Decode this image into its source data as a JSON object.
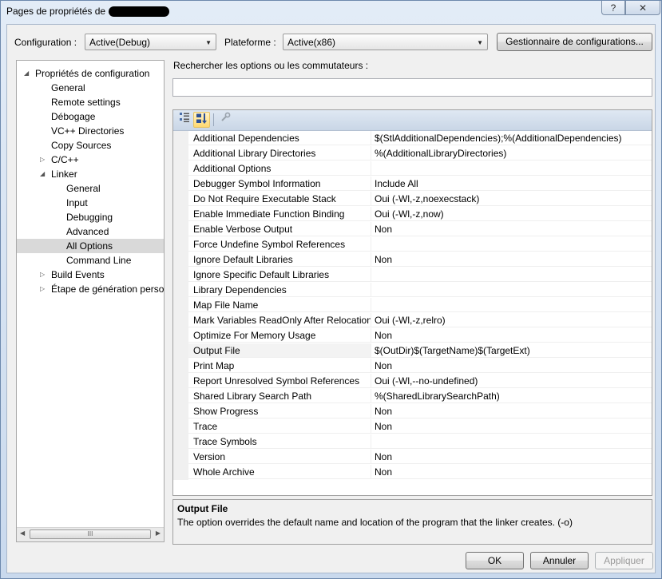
{
  "window": {
    "title": "Pages de propriétés de",
    "help_label": "?",
    "close_label": "✕"
  },
  "config_bar": {
    "configuration_label": "Configuration :",
    "configuration_value": "Active(Debug)",
    "platform_label": "Plateforme :",
    "platform_value": "Active(x86)",
    "manager_button": "Gestionnaire de configurations..."
  },
  "tree": {
    "items": [
      {
        "label": "Propriétés de configuration",
        "level": 0,
        "toggle": "expanded"
      },
      {
        "label": "General",
        "level": 1,
        "toggle": "none"
      },
      {
        "label": "Remote settings",
        "level": 1,
        "toggle": "none"
      },
      {
        "label": "Débogage",
        "level": 1,
        "toggle": "none"
      },
      {
        "label": "VC++ Directories",
        "level": 1,
        "toggle": "none"
      },
      {
        "label": "Copy Sources",
        "level": 1,
        "toggle": "none"
      },
      {
        "label": "C/C++",
        "level": 1,
        "toggle": "collapsed"
      },
      {
        "label": "Linker",
        "level": 1,
        "toggle": "expanded"
      },
      {
        "label": "General",
        "level": 2,
        "toggle": "none"
      },
      {
        "label": "Input",
        "level": 2,
        "toggle": "none"
      },
      {
        "label": "Debugging",
        "level": 2,
        "toggle": "none"
      },
      {
        "label": "Advanced",
        "level": 2,
        "toggle": "none"
      },
      {
        "label": "All Options",
        "level": 2,
        "toggle": "none",
        "selected": true
      },
      {
        "label": "Command Line",
        "level": 2,
        "toggle": "none"
      },
      {
        "label": "Build Events",
        "level": 1,
        "toggle": "collapsed"
      },
      {
        "label": "Étape de génération person",
        "level": 1,
        "toggle": "collapsed"
      }
    ],
    "scroll_left": "◀",
    "scroll_right": "▶",
    "scroll_thumb_grip": "III"
  },
  "search": {
    "label": "Rechercher les options ou les commutateurs :",
    "value": ""
  },
  "grid": {
    "rows": [
      {
        "name": "Additional Dependencies",
        "value": "$(StlAdditionalDependencies);%(AdditionalDependencies)"
      },
      {
        "name": "Additional Library Directories",
        "value": "%(AdditionalLibraryDirectories)"
      },
      {
        "name": "Additional Options",
        "value": ""
      },
      {
        "name": "Debugger Symbol Information",
        "value": "Include All"
      },
      {
        "name": "Do Not Require Executable Stack",
        "value": "Oui (-Wl,-z,noexecstack)"
      },
      {
        "name": "Enable Immediate Function Binding",
        "value": "Oui (-Wl,-z,now)"
      },
      {
        "name": "Enable Verbose Output",
        "value": "Non"
      },
      {
        "name": "Force Undefine Symbol References",
        "value": ""
      },
      {
        "name": "Ignore Default Libraries",
        "value": "Non"
      },
      {
        "name": "Ignore Specific Default Libraries",
        "value": ""
      },
      {
        "name": "Library Dependencies",
        "value": ""
      },
      {
        "name": "Map File Name",
        "value": ""
      },
      {
        "name": "Mark Variables ReadOnly After Relocation",
        "value": "Oui (-Wl,-z,relro)"
      },
      {
        "name": "Optimize For Memory Usage",
        "value": "Non"
      },
      {
        "name": "Output File",
        "value": "$(OutDir)$(TargetName)$(TargetExt)",
        "selected": true
      },
      {
        "name": "Print Map",
        "value": "Non"
      },
      {
        "name": "Report Unresolved Symbol References",
        "value": "Oui (-Wl,--no-undefined)"
      },
      {
        "name": "Shared Library Search Path",
        "value": "%(SharedLibrarySearchPath)"
      },
      {
        "name": "Show Progress",
        "value": "Non"
      },
      {
        "name": "Trace",
        "value": "Non"
      },
      {
        "name": "Trace Symbols",
        "value": ""
      },
      {
        "name": "Version",
        "value": "Non"
      },
      {
        "name": "Whole Archive",
        "value": "Non"
      }
    ]
  },
  "description": {
    "title": "Output File",
    "text": "The option overrides the default name and location of the program that the linker creates. (-o)"
  },
  "buttons": {
    "ok": "OK",
    "cancel": "Annuler",
    "apply": "Appliquer"
  }
}
